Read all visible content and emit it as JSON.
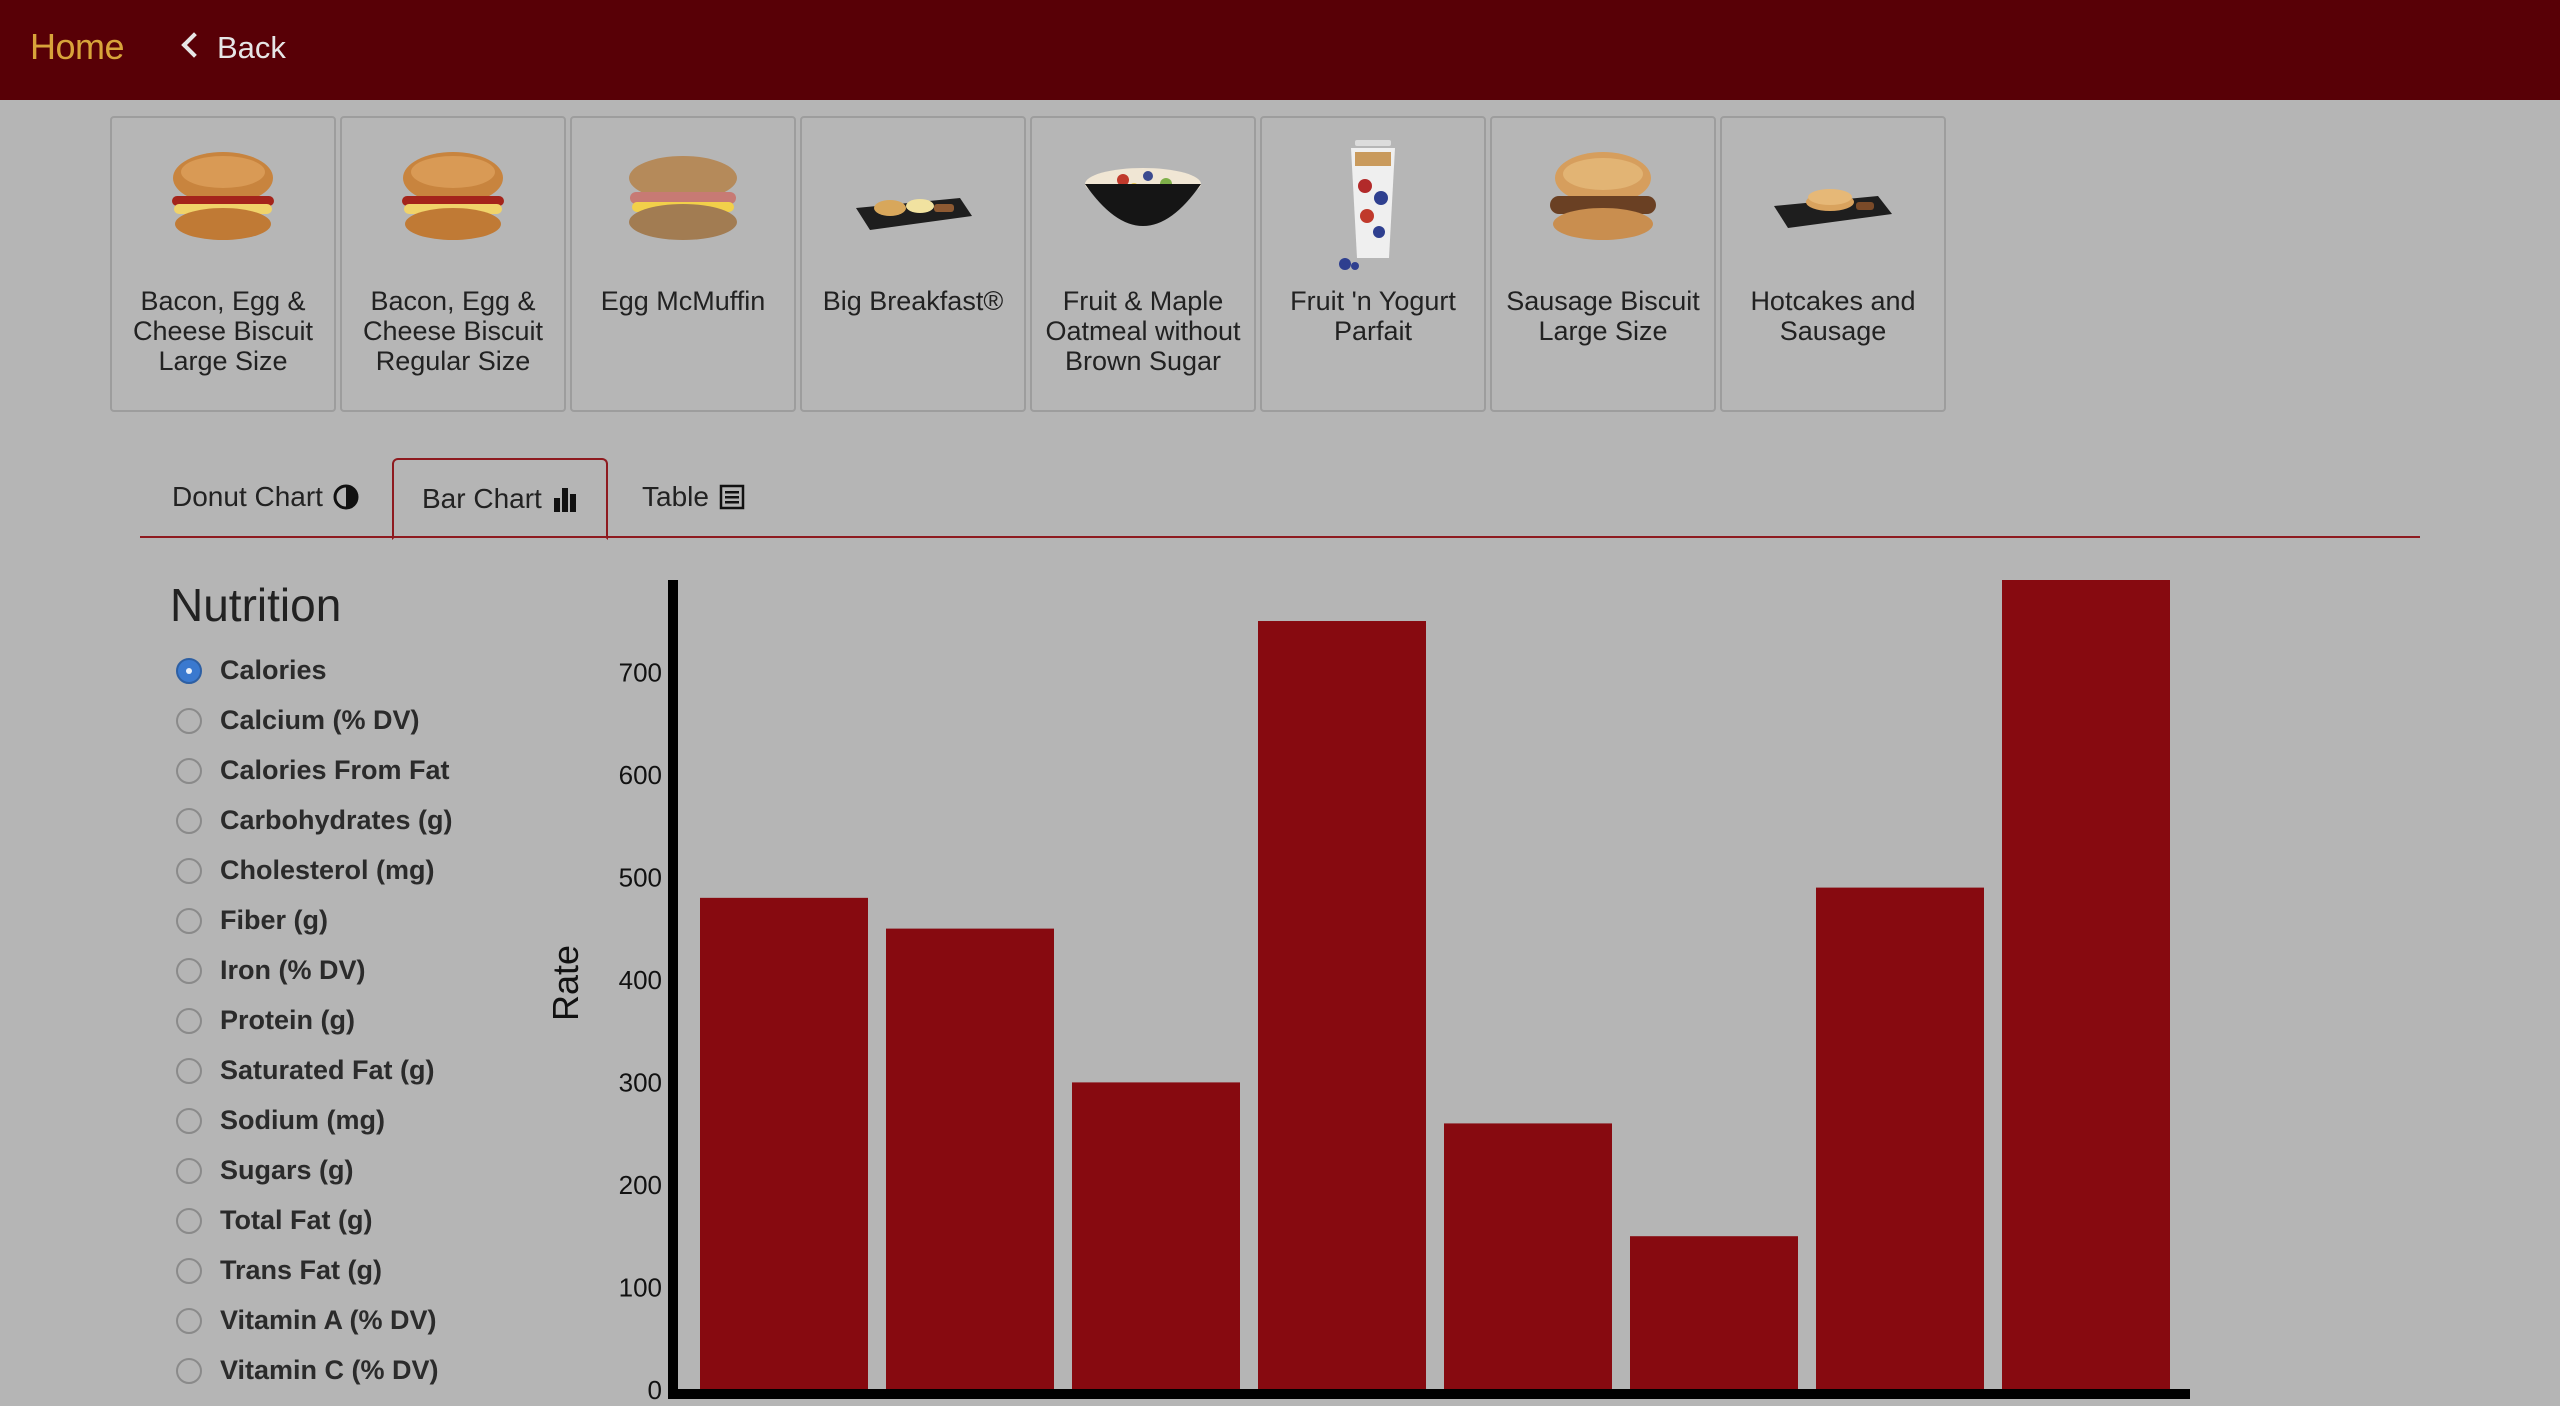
{
  "nav": {
    "home": "Home",
    "back": "Back"
  },
  "products": [
    {
      "name": "Bacon, Egg & Cheese Biscuit Large Size",
      "icon": "biscuit-sandwich-icon"
    },
    {
      "name": "Bacon, Egg & Cheese Biscuit Regular Size",
      "icon": "biscuit-sandwich-icon"
    },
    {
      "name": "Egg McMuffin",
      "icon": "muffin-sandwich-icon"
    },
    {
      "name": "Big Breakfast®",
      "icon": "breakfast-platter-icon"
    },
    {
      "name": "Fruit & Maple Oatmeal without Brown Sugar",
      "icon": "oatmeal-bowl-icon"
    },
    {
      "name": "Fruit 'n Yogurt Parfait",
      "icon": "parfait-cup-icon"
    },
    {
      "name": "Sausage Biscuit Large Size",
      "icon": "sausage-biscuit-icon"
    },
    {
      "name": "Hotcakes and Sausage",
      "icon": "hotcakes-platter-icon"
    }
  ],
  "tabs": [
    {
      "label": "Donut Chart",
      "icon": "half-circle-icon"
    },
    {
      "label": "Bar Chart",
      "icon": "bar-chart-icon",
      "active": true
    },
    {
      "label": "Table",
      "icon": "table-list-icon"
    }
  ],
  "nutrition": {
    "title": "Nutrition",
    "selected": "Calories",
    "options": [
      "Calories",
      "Calcium (% DV)",
      "Calories From Fat",
      "Carbohydrates (g)",
      "Cholesterol (mg)",
      "Fiber (g)",
      "Iron (% DV)",
      "Protein (g)",
      "Saturated Fat (g)",
      "Sodium (mg)",
      "Sugars (g)",
      "Total Fat (g)",
      "Trans Fat (g)",
      "Vitamin A (% DV)",
      "Vitamin C (% DV)"
    ]
  },
  "colors": {
    "topbar": "#580006",
    "bar": "#870a10",
    "accent": "#8e1a1f",
    "home": "#d8a33a"
  },
  "chart_data": {
    "type": "bar",
    "categories": [
      "Bacon, Egg & Cheese Biscuit Large Size",
      "Bacon, Egg & Cheese Biscuit Regular Size",
      "Egg McMuffin",
      "Big Breakfast®",
      "Fruit & Maple Oatmeal without Brown Sugar",
      "Fruit 'n Yogurt Parfait",
      "Sausage Biscuit Large Size",
      "Hotcakes and Sausage"
    ],
    "values": [
      480,
      450,
      300,
      750,
      260,
      150,
      490,
      790
    ],
    "ylabel": "Rate",
    "yticks": [
      0,
      100,
      200,
      300,
      400,
      500,
      600,
      700
    ],
    "ylim": [
      0,
      790
    ],
    "grid": false
  }
}
